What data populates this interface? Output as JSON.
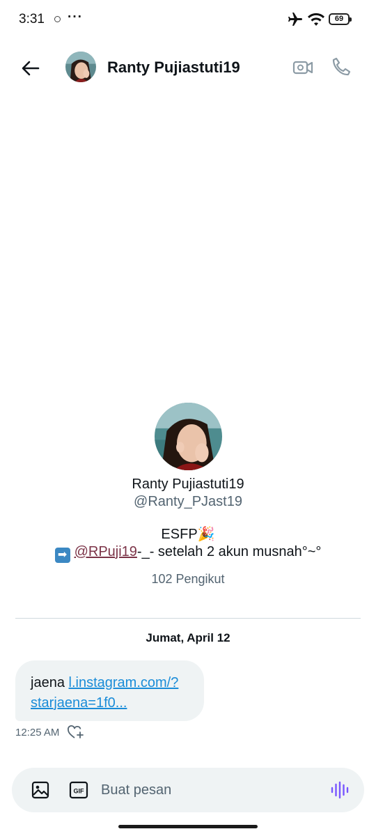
{
  "status_bar": {
    "time": "3:31",
    "more": "···",
    "battery": "69",
    "icons": [
      "airplane-icon",
      "wifi-icon",
      "battery-icon"
    ]
  },
  "header": {
    "name": "Ranty Pujiastuti19",
    "icons": [
      "back-arrow-icon",
      "video-call-icon",
      "phone-icon"
    ]
  },
  "profile": {
    "name": "Ranty Pujiastuti19",
    "handle": "@Ranty_PJast19",
    "bio_line1": "ESFP",
    "bio_emoji": "🎉",
    "bio_arrow": "➡",
    "bio_mention": "@RPuji19",
    "bio_rest": "-_- setelah 2 akun musnah°~°",
    "followers": "102 Pengikut"
  },
  "conversation": {
    "date": "Jumat, April 12",
    "messages": [
      {
        "text": "jaena",
        "link": "l.instagram.com/?starjaena=1f0...",
        "link_line1": "l.instagram.com/?",
        "link_line2": "starjaena=1f0...",
        "time": "12:25 AM"
      }
    ]
  },
  "composer": {
    "placeholder": "Buat pesan",
    "icons": [
      "image-icon",
      "gif-icon",
      "voice-icon"
    ]
  },
  "colors": {
    "accent": "#1d9bf0",
    "voice": "#7856ff",
    "bubble": "#eff3f4",
    "muted": "#536471"
  }
}
